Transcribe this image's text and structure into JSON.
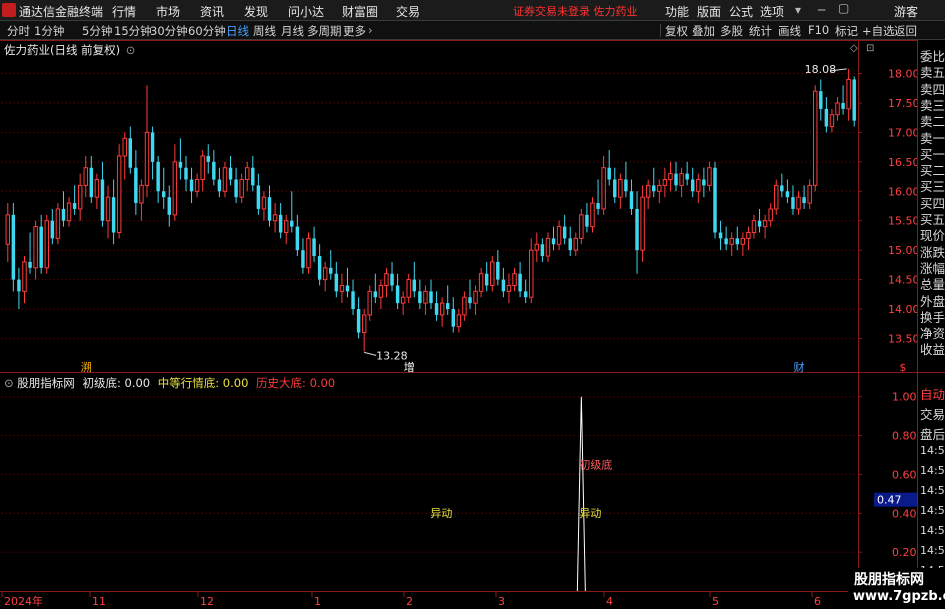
{
  "menubar": {
    "app_title": "通达信金融终端",
    "menus": [
      "行情",
      "市场",
      "资讯",
      "发现",
      "问小达",
      "财富圈",
      "交易"
    ],
    "status": "证券交易未登录  佐力药业",
    "right_items": [
      "功能",
      "版面",
      "公式",
      "选项",
      "游客"
    ]
  },
  "toolbar": {
    "periods": [
      "分时",
      "1分钟",
      "5分钟",
      "15分钟",
      "30分钟",
      "60分钟",
      "日线",
      "周线",
      "月线",
      "多周期",
      "更多"
    ],
    "active_period": "日线",
    "right_buttons": [
      "复权",
      "叠加",
      "多股",
      "统计",
      "画线",
      "F10",
      "标记",
      "+自选",
      "返回"
    ]
  },
  "main_chart": {
    "title": "佐力药业(日线 前复权)",
    "y_ticks": [
      "18.00",
      "17.50",
      "17.00",
      "16.50",
      "16.00",
      "15.50",
      "15.00",
      "14.50",
      "14.00",
      "13.50"
    ],
    "high_label": "18.08",
    "low_label": "13.28",
    "event_markers": [
      {
        "text": "溯",
        "x_index": 14
      },
      {
        "text": "增",
        "x_index": 72
      },
      {
        "text": "财",
        "x_index": 142
      },
      {
        "text": "$",
        "x_index": 161
      }
    ],
    "x_labels": [
      "2024年",
      "11",
      "12",
      "1",
      "2",
      "3",
      "4",
      "5",
      "6"
    ]
  },
  "indicator": {
    "name": "股朋指标网",
    "line1_label": "初级底: 0.00",
    "line2_label": "中等行情底: 0.00",
    "line3_label": "历史大底: 0.00",
    "y_ticks": [
      "1.00",
      "0.80",
      "0.60",
      "0.40",
      "0.20"
    ],
    "current_value": "0.47",
    "annotations": [
      {
        "text": "异动",
        "kind": "yellow"
      },
      {
        "text": "初级底",
        "kind": "red"
      },
      {
        "text": "异动",
        "kind": "yellow"
      }
    ]
  },
  "side_panel": {
    "quote_labels": [
      "委比",
      "卖五",
      "卖四",
      "卖三",
      "卖二",
      "卖一",
      "买一",
      "买二",
      "买三",
      "买四",
      "买五",
      "现价",
      "涨跌",
      "涨幅",
      "总量",
      "外盘",
      "换手",
      "净资",
      "收益"
    ],
    "lower_labels": [
      "自动",
      "交易",
      "盘后",
      "14:56",
      "14:56",
      "14:56",
      "14:56",
      "14:56",
      "14:56",
      "14:56",
      "14:56"
    ]
  },
  "watermark": {
    "line1": "股朋指标网",
    "line2": "www.7gpzb.com"
  },
  "colors": {
    "up": "#ff3b3b",
    "down": "#3ed8f0",
    "accent": "#4aa0ff",
    "yellow": "#e8e040",
    "grid_red": "#8a1a1a"
  },
  "chart_data": {
    "type": "candlestick",
    "title": "佐力药业(日线 前复权)",
    "ylim": [
      13.1,
      18.4
    ],
    "ohlc": [
      [
        15.1,
        15.8,
        14.8,
        15.6
      ],
      [
        15.6,
        15.8,
        14.3,
        14.5
      ],
      [
        14.5,
        14.7,
        14.0,
        14.3
      ],
      [
        14.3,
        14.9,
        14.1,
        14.8
      ],
      [
        14.8,
        15.3,
        14.6,
        14.7
      ],
      [
        14.7,
        15.5,
        14.5,
        15.4
      ],
      [
        15.4,
        15.6,
        14.6,
        14.7
      ],
      [
        14.7,
        15.6,
        14.6,
        15.5
      ],
      [
        15.5,
        15.7,
        15.1,
        15.2
      ],
      [
        15.2,
        15.8,
        15.1,
        15.7
      ],
      [
        15.7,
        16.0,
        15.4,
        15.5
      ],
      [
        15.5,
        15.9,
        15.4,
        15.8
      ],
      [
        15.8,
        16.1,
        15.6,
        15.7
      ],
      [
        15.7,
        16.3,
        15.5,
        16.1
      ],
      [
        16.1,
        16.6,
        15.9,
        16.4
      ],
      [
        16.4,
        16.6,
        15.8,
        15.9
      ],
      [
        15.9,
        16.3,
        15.7,
        16.2
      ],
      [
        16.2,
        16.5,
        15.4,
        15.5
      ],
      [
        15.5,
        16.1,
        15.2,
        15.9
      ],
      [
        15.9,
        16.2,
        15.1,
        15.3
      ],
      [
        15.3,
        16.8,
        15.2,
        16.6
      ],
      [
        16.6,
        17.0,
        16.2,
        16.9
      ],
      [
        16.9,
        17.1,
        16.3,
        16.4
      ],
      [
        16.4,
        16.7,
        15.6,
        15.8
      ],
      [
        15.8,
        16.2,
        15.5,
        16.1
      ],
      [
        16.1,
        17.8,
        15.9,
        17.0
      ],
      [
        17.0,
        17.1,
        16.2,
        16.5
      ],
      [
        16.5,
        16.6,
        15.8,
        16.0
      ],
      [
        16.0,
        16.4,
        15.7,
        15.9
      ],
      [
        15.9,
        16.1,
        15.4,
        15.6
      ],
      [
        15.6,
        16.8,
        15.5,
        16.5
      ],
      [
        16.5,
        16.9,
        16.2,
        16.4
      ],
      [
        16.4,
        16.6,
        16.0,
        16.2
      ],
      [
        16.2,
        16.4,
        15.8,
        16.0
      ],
      [
        16.0,
        16.3,
        15.9,
        16.2
      ],
      [
        16.2,
        16.7,
        16.0,
        16.6
      ],
      [
        16.6,
        16.8,
        16.3,
        16.5
      ],
      [
        16.5,
        16.7,
        16.1,
        16.2
      ],
      [
        16.2,
        16.4,
        15.9,
        16.0
      ],
      [
        16.0,
        16.5,
        15.9,
        16.4
      ],
      [
        16.4,
        16.6,
        16.1,
        16.2
      ],
      [
        16.2,
        16.4,
        15.8,
        15.9
      ],
      [
        15.9,
        16.3,
        15.8,
        16.2
      ],
      [
        16.2,
        16.5,
        16.0,
        16.4
      ],
      [
        16.4,
        16.6,
        16.0,
        16.1
      ],
      [
        16.1,
        16.3,
        15.6,
        15.7
      ],
      [
        15.7,
        16.0,
        15.5,
        15.9
      ],
      [
        15.9,
        16.1,
        15.4,
        15.5
      ],
      [
        15.5,
        15.8,
        15.3,
        15.6
      ],
      [
        15.6,
        15.8,
        15.2,
        15.3
      ],
      [
        15.3,
        15.6,
        15.1,
        15.5
      ],
      [
        15.5,
        16.0,
        15.3,
        15.4
      ],
      [
        15.4,
        15.6,
        14.9,
        15.0
      ],
      [
        15.0,
        15.2,
        14.6,
        14.7
      ],
      [
        14.7,
        15.3,
        14.6,
        15.2
      ],
      [
        15.2,
        15.4,
        14.8,
        14.9
      ],
      [
        14.9,
        15.1,
        14.4,
        14.5
      ],
      [
        14.5,
        14.8,
        14.3,
        14.7
      ],
      [
        14.7,
        15.0,
        14.5,
        14.6
      ],
      [
        14.6,
        14.8,
        14.2,
        14.3
      ],
      [
        14.3,
        14.6,
        14.1,
        14.4
      ],
      [
        14.4,
        14.7,
        14.2,
        14.3
      ],
      [
        14.3,
        14.5,
        13.9,
        14.0
      ],
      [
        14.0,
        14.2,
        13.5,
        13.6
      ],
      [
        13.6,
        14.0,
        13.28,
        13.9
      ],
      [
        13.9,
        14.4,
        13.8,
        14.3
      ],
      [
        14.3,
        14.6,
        14.1,
        14.2
      ],
      [
        14.2,
        14.5,
        14.0,
        14.4
      ],
      [
        14.4,
        14.7,
        14.2,
        14.6
      ],
      [
        14.6,
        14.8,
        14.3,
        14.4
      ],
      [
        14.4,
        14.6,
        14.0,
        14.1
      ],
      [
        14.1,
        14.3,
        13.9,
        14.2
      ],
      [
        14.2,
        14.6,
        14.1,
        14.5
      ],
      [
        14.5,
        14.8,
        14.2,
        14.3
      ],
      [
        14.3,
        14.5,
        14.0,
        14.1
      ],
      [
        14.1,
        14.4,
        13.9,
        14.3
      ],
      [
        14.3,
        14.5,
        14.0,
        14.1
      ],
      [
        14.1,
        14.3,
        13.8,
        13.9
      ],
      [
        13.9,
        14.2,
        13.7,
        14.1
      ],
      [
        14.1,
        14.4,
        13.9,
        14.0
      ],
      [
        14.0,
        14.2,
        13.6,
        13.7
      ],
      [
        13.7,
        14.0,
        13.6,
        13.9
      ],
      [
        13.9,
        14.3,
        13.8,
        14.2
      ],
      [
        14.2,
        14.5,
        14.0,
        14.1
      ],
      [
        14.1,
        14.4,
        13.9,
        14.3
      ],
      [
        14.3,
        14.7,
        14.2,
        14.6
      ],
      [
        14.6,
        14.8,
        14.3,
        14.4
      ],
      [
        14.4,
        14.9,
        14.3,
        14.8
      ],
      [
        14.8,
        15.0,
        14.4,
        14.5
      ],
      [
        14.5,
        14.7,
        14.2,
        14.3
      ],
      [
        14.3,
        14.6,
        14.1,
        14.4
      ],
      [
        14.4,
        14.7,
        14.3,
        14.6
      ],
      [
        14.6,
        14.8,
        14.2,
        14.3
      ],
      [
        14.3,
        14.5,
        14.1,
        14.2
      ],
      [
        14.2,
        15.2,
        14.1,
        15.0
      ],
      [
        15.0,
        15.3,
        14.8,
        15.1
      ],
      [
        15.1,
        15.2,
        14.8,
        14.9
      ],
      [
        14.9,
        15.3,
        14.8,
        15.2
      ],
      [
        15.2,
        15.4,
        15.0,
        15.1
      ],
      [
        15.1,
        15.5,
        15.0,
        15.4
      ],
      [
        15.4,
        15.6,
        15.1,
        15.2
      ],
      [
        15.2,
        15.4,
        14.9,
        15.0
      ],
      [
        15.0,
        15.3,
        14.9,
        15.2
      ],
      [
        15.2,
        15.7,
        15.1,
        15.6
      ],
      [
        15.6,
        15.8,
        15.3,
        15.4
      ],
      [
        15.4,
        15.9,
        15.3,
        15.8
      ],
      [
        15.8,
        16.2,
        15.6,
        15.7
      ],
      [
        15.7,
        16.6,
        15.6,
        16.4
      ],
      [
        16.4,
        16.7,
        16.1,
        16.2
      ],
      [
        16.2,
        16.4,
        15.8,
        15.9
      ],
      [
        15.9,
        16.3,
        15.7,
        16.2
      ],
      [
        16.2,
        16.5,
        15.9,
        16.0
      ],
      [
        16.0,
        16.2,
        15.6,
        15.7
      ],
      [
        15.7,
        16.0,
        14.6,
        15.0
      ],
      [
        15.0,
        16.1,
        14.8,
        15.9
      ],
      [
        15.9,
        16.2,
        15.7,
        16.1
      ],
      [
        16.1,
        16.4,
        15.9,
        16.0
      ],
      [
        16.0,
        16.2,
        15.8,
        16.1
      ],
      [
        16.1,
        16.4,
        15.9,
        16.2
      ],
      [
        16.2,
        16.5,
        16.0,
        16.3
      ],
      [
        16.3,
        16.5,
        16.0,
        16.1
      ],
      [
        16.1,
        16.4,
        15.9,
        16.3
      ],
      [
        16.3,
        16.5,
        16.1,
        16.2
      ],
      [
        16.2,
        16.4,
        15.9,
        16.0
      ],
      [
        16.0,
        16.3,
        15.8,
        16.2
      ],
      [
        16.2,
        16.4,
        15.9,
        16.1
      ],
      [
        16.1,
        16.5,
        16.0,
        16.4
      ],
      [
        16.4,
        16.5,
        15.2,
        15.3
      ],
      [
        15.3,
        15.5,
        15.0,
        15.2
      ],
      [
        15.2,
        15.4,
        15.0,
        15.1
      ],
      [
        15.1,
        15.3,
        14.9,
        15.2
      ],
      [
        15.2,
        15.4,
        15.0,
        15.1
      ],
      [
        15.1,
        15.3,
        14.9,
        15.2
      ],
      [
        15.2,
        15.4,
        15.0,
        15.3
      ],
      [
        15.3,
        15.6,
        15.2,
        15.5
      ],
      [
        15.5,
        15.7,
        15.3,
        15.4
      ],
      [
        15.4,
        15.6,
        15.2,
        15.5
      ],
      [
        15.5,
        15.8,
        15.4,
        15.7
      ],
      [
        15.7,
        16.2,
        15.6,
        16.1
      ],
      [
        16.1,
        16.3,
        15.9,
        16.0
      ],
      [
        16.0,
        16.2,
        15.8,
        15.9
      ],
      [
        15.9,
        16.1,
        15.6,
        15.7
      ],
      [
        15.7,
        16.0,
        15.6,
        15.9
      ],
      [
        15.9,
        16.1,
        15.7,
        15.8
      ],
      [
        15.8,
        16.2,
        15.7,
        16.1
      ],
      [
        16.1,
        17.8,
        16.0,
        17.7
      ],
      [
        17.7,
        17.9,
        17.2,
        17.4
      ],
      [
        17.4,
        17.6,
        17.0,
        17.1
      ],
      [
        17.1,
        17.4,
        17.0,
        17.3
      ],
      [
        17.3,
        17.6,
        17.2,
        17.5
      ],
      [
        17.5,
        17.8,
        17.3,
        17.4
      ],
      [
        17.4,
        18.08,
        17.2,
        17.9
      ],
      [
        17.9,
        17.95,
        17.1,
        17.2
      ]
    ],
    "indicator_series": {
      "name": "初级底",
      "spike_index": 103,
      "spike_value": 1.0,
      "ylim": [
        0,
        1.05
      ]
    }
  }
}
